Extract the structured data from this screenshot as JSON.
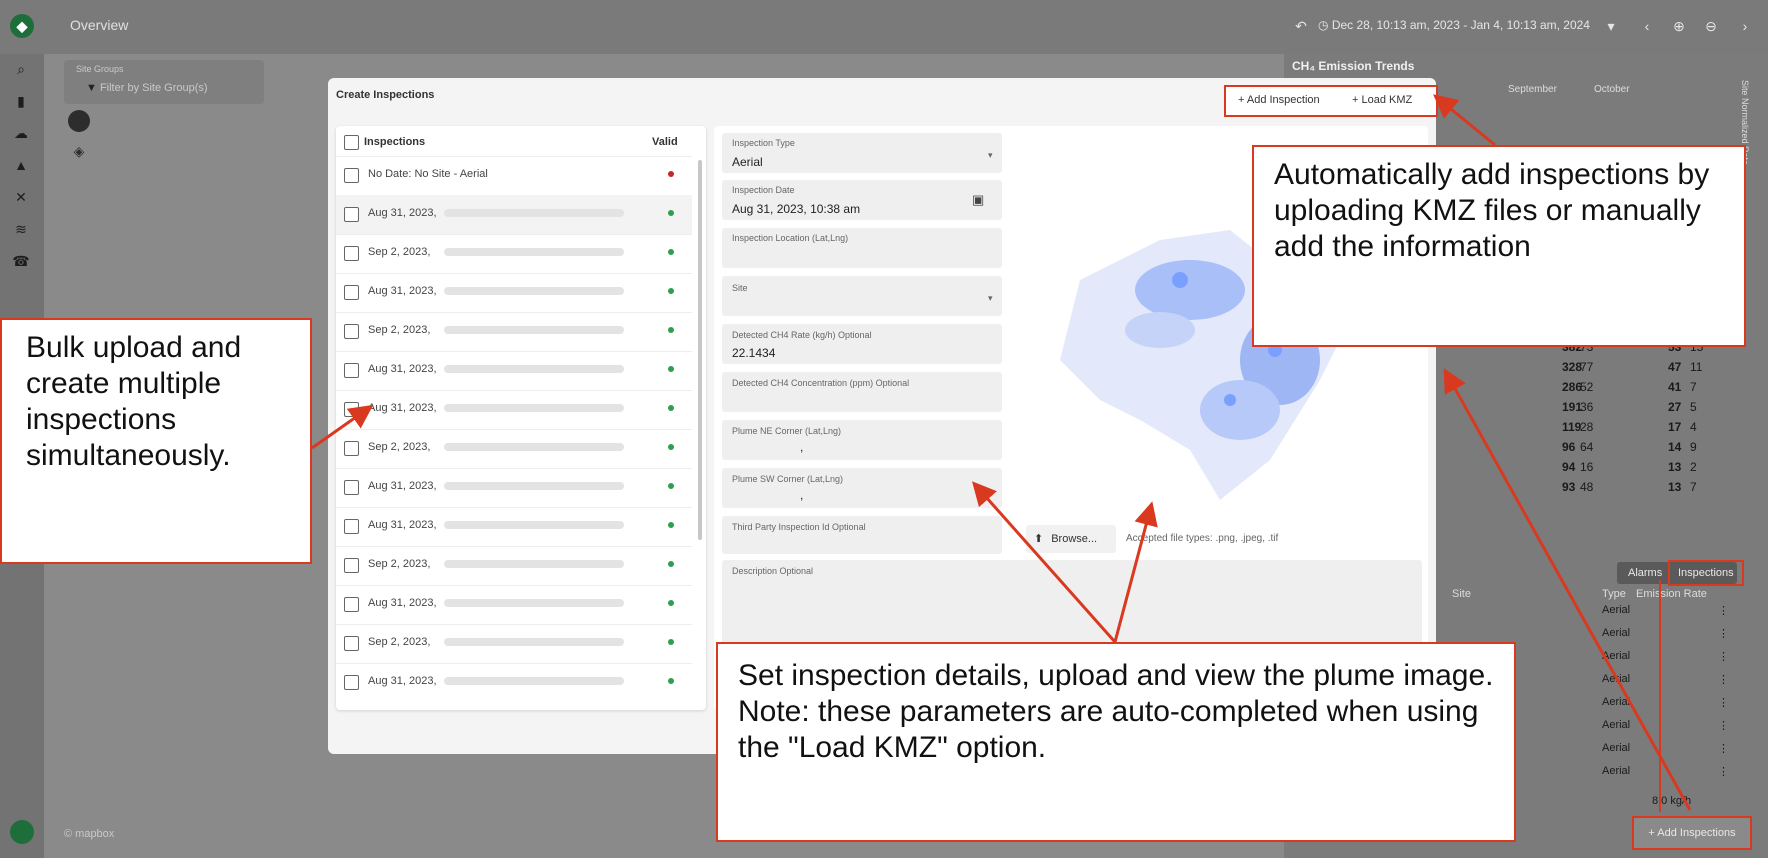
{
  "app": {
    "title": "Overview",
    "date_range": "Dec 28, 10:13 am, 2023 - Jan 4, 10:13 am, 2024"
  },
  "map": {
    "site_groups_label": "Site Groups",
    "site_groups_placeholder": "Filter by Site Group(s)",
    "mapbox_label": "© mapbox"
  },
  "right_panel": {
    "title": "CH₄ Emission Trends",
    "months": [
      "September",
      "October"
    ],
    "y_axis_label": "Site Normalized Rate",
    "stats": [
      {
        "a": "382",
        "b": "73",
        "c": "53",
        "d": "15"
      },
      {
        "a": "328",
        "b": "77",
        "c": "47",
        "d": "11"
      },
      {
        "a": "286",
        "b": "52",
        "c": "41",
        "d": "7"
      },
      {
        "a": "191",
        "b": "36",
        "c": "27",
        "d": "5"
      },
      {
        "a": "119",
        "b": "28",
        "c": "17",
        "d": "4"
      },
      {
        "a": "96",
        "b": "64",
        "c": "14",
        "d": "9"
      },
      {
        "a": "94",
        "b": "16",
        "c": "13",
        "d": "2"
      },
      {
        "a": "93",
        "b": "48",
        "c": "13",
        "d": "7"
      }
    ],
    "tabs": [
      "Alarms",
      "Inspections"
    ],
    "table_headers": [
      "Site",
      "Type",
      "Emission Rate"
    ],
    "table_types": [
      "Aerial",
      "Aerial",
      "Aerial",
      "Aerial",
      "Aerial",
      "Aerial",
      "Aerial",
      "Aerial"
    ],
    "last_rate": "8.0 kg/h",
    "add_inspections_label": "+  Add Inspections"
  },
  "modal": {
    "title": "Create Inspections",
    "add_inspection_label": "+  Add Inspection",
    "load_kmz_label": "+  Load KMZ",
    "list_header": "Inspections",
    "valid_header": "Valid",
    "rows": [
      {
        "label": "No Date: No Site - Aerial",
        "status": "invalid"
      },
      {
        "label": "Aug 31, 2023,",
        "status": "valid"
      },
      {
        "label": "Sep 2, 2023,",
        "status": "valid"
      },
      {
        "label": "Aug 31, 2023,",
        "status": "valid"
      },
      {
        "label": "Sep 2, 2023,",
        "status": "valid"
      },
      {
        "label": "Aug 31, 2023,",
        "status": "valid"
      },
      {
        "label": "Aug 31, 2023,",
        "status": "valid"
      },
      {
        "label": "Sep 2, 2023,",
        "status": "valid"
      },
      {
        "label": "Aug 31, 2023,",
        "status": "valid"
      },
      {
        "label": "Aug 31, 2023,",
        "status": "valid"
      },
      {
        "label": "Sep 2, 2023,",
        "status": "valid"
      },
      {
        "label": "Aug 31, 2023,",
        "status": "valid"
      },
      {
        "label": "Sep 2, 2023,",
        "status": "valid"
      },
      {
        "label": "Aug 31, 2023,",
        "status": "valid"
      }
    ],
    "form": {
      "inspection_type_label": "Inspection Type",
      "inspection_type_value": "Aerial",
      "inspection_date_label": "Inspection Date",
      "inspection_date_value": "Aug 31, 2023, 10:38 am",
      "location_label": "Inspection Location (Lat,Lng)",
      "site_label": "Site",
      "rate_label": "Detected CH4 Rate (kg/h) Optional",
      "rate_value": "22.1434",
      "concentration_label": "Detected CH4 Concentration (ppm) Optional",
      "ne_corner_label": "Plume NE Corner (Lat,Lng)",
      "ne_corner_value": ",",
      "sw_corner_label": "Plume SW Corner (Lat,Lng)",
      "sw_corner_value": ",",
      "third_party_label": "Third Party Inspection Id Optional",
      "browse_label": "Browse...",
      "accepted_types": "Accepted file types: .png, .jpeg, .tif",
      "description_label": "Description Optional"
    }
  },
  "callouts": {
    "top_right": "Automatically add inspections by uploading KMZ files or manually add the information",
    "left": "Bulk upload and create multiple inspections simultaneously.",
    "bottom": "Set inspection details, upload and view the plume image.\nNote: these parameters are auto-completed when using the \"Load KMZ\" option."
  },
  "colors": {
    "accent_red": "#d9391f",
    "valid_green": "#2e9e4f",
    "invalid_red": "#c62828",
    "plume_blue": "#7aa0ff"
  }
}
